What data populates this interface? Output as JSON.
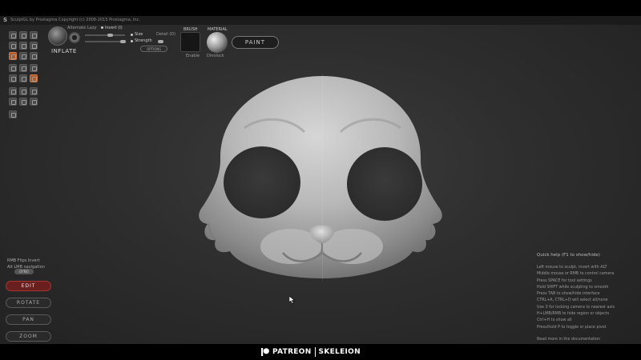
{
  "titlebar": {
    "app": "SculptGL by Prostagma",
    "copyright": "Copyright (c) 2008-2015 Prostagma, Inc."
  },
  "toolbar": {
    "alternate_label": "Alternate",
    "lazy_label": "Lazy",
    "invert_label": "Invert (I)",
    "size_label": "Size",
    "strength_label": "Strength",
    "detail_label": "Detail (D)",
    "brush_name": "INFLATE",
    "options_label": "OPTIONS",
    "brush_title": "BRUSH",
    "brush_sub": "Enable",
    "material_title": "MATERIAL",
    "material_sub": "Dinolock",
    "paint_label": "PAINT"
  },
  "left_notes": {
    "rmb": "RMB Flips Invert",
    "lmb": "Alt LMB navigation",
    "remesh_label": "DYNO"
  },
  "modes": [
    {
      "label": "EDIT",
      "active": true
    },
    {
      "label": "ROTATE",
      "active": false
    },
    {
      "label": "PAN",
      "active": false
    },
    {
      "label": "ZOOM",
      "active": false
    }
  ],
  "quick_help": {
    "title": "Quick help (F1 to show/hide)",
    "lines": [
      "Left mouse to sculpt, invert with ALT",
      "Middle mouse or RMB to control camera",
      "Press SPACE for tool settings",
      "Hold SHIFT while sculpting to smooth",
      "Press TAB to show/hide interface",
      "CTRL+A, CTRL+D will select all/none",
      "Use 3 for locking camera to nearest axis",
      "H+LMB/RMB to hide region or objects",
      "Ctrl+H to show all",
      "Press/hold P to toggle or place pivot"
    ],
    "more": "Read more in the documentation"
  },
  "watermark": {
    "left": "PATREON",
    "right": "SKELEION"
  },
  "colors": {
    "accent_active": "#6a1f1f",
    "tool_highlight": "#b05a2a"
  }
}
